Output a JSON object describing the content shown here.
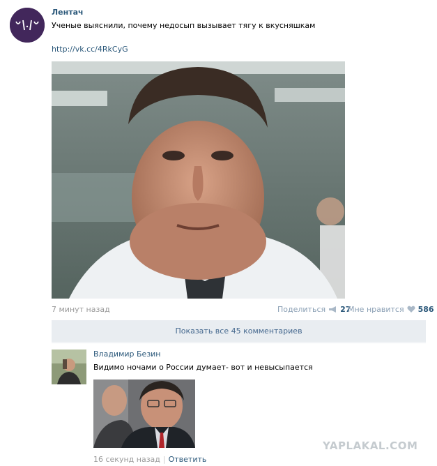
{
  "post": {
    "author": "Лентач",
    "text": "Ученые выяснили, почему недосып вызывает тягу к вкусняшкам",
    "link": "http://vk.cc/4RkCyG",
    "time": "7 минут назад",
    "share_label": "Поделиться",
    "share_count": "27",
    "like_label": "Мне нравится",
    "like_count": "586"
  },
  "comments": {
    "show_all_label": "Показать все 45 комментариев",
    "items": [
      {
        "author": "Владимир Безин",
        "text": "Видимо ночами о России думает- вот и невысыпается",
        "time": "16 секунд назад",
        "reply_label": "Ответить"
      }
    ]
  },
  "watermark": "YAPLAKAL.COM",
  "colors": {
    "link": "#2b587a",
    "muted": "#999999",
    "button_bg": "#e9edf1",
    "avatar_bg": "#42275b"
  }
}
